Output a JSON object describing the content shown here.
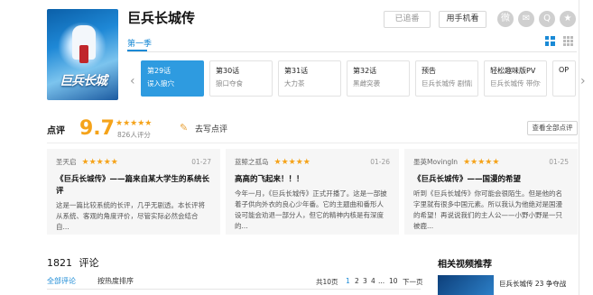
{
  "show": {
    "title": "巨兵长城传",
    "poster_text": "巨兵长城",
    "followed_label": "已追番",
    "phone_label": "用手机看"
  },
  "share_icons": [
    "weibo-icon",
    "wechat-icon",
    "qq-icon",
    "qzone-icon"
  ],
  "season_tab": "第一季",
  "episodes": [
    {
      "num": "第29话",
      "sub": "误入狼穴",
      "active": true
    },
    {
      "num": "第30话",
      "sub": "狼口夺食",
      "active": false
    },
    {
      "num": "第31话",
      "sub": "大力茶",
      "active": false
    },
    {
      "num": "第32话",
      "sub": "黑雌突袭",
      "active": false
    },
    {
      "num": "预告",
      "sub": "巨兵长城传 剧情版预告，超酷上线",
      "active": false
    },
    {
      "num": "轻松趣味版PV",
      "sub": "巨兵长城传 带你认识一只吃草的狼",
      "active": false
    },
    {
      "num": "OP",
      "sub": "",
      "active": false
    }
  ],
  "rating": {
    "heading": "点评",
    "score": "9.7",
    "stars": "★★★★★",
    "count": "826人评分",
    "write_label": "去写点评",
    "all_label": "查看全部点评"
  },
  "reviews": [
    {
      "user": "圣天启",
      "stars": "★★★★★",
      "date": "01-27",
      "title": "《巨兵长城传》——篇来自某大学生的系统长评",
      "body": "这是一篇比较系统的长评，几乎无剧透。本长评将从系统、客观的角度评价，尽管实际必然会结合自..."
    },
    {
      "user": "蓝鲸之孤岛",
      "stars": "★★★★★",
      "date": "01-26",
      "title": "高高的飞起来！！！",
      "body": "今年一月，《巨兵长城传》正式开播了。这是一部披着子供向外衣的良心少年番。它的主题曲和番形人设可能会劝退一部分人，但它的精神内核是有深度的..."
    },
    {
      "user": "墨英MovingIn",
      "stars": "★★★★★",
      "date": "01-25",
      "title": "《巨兵长城传》——国漫的希望",
      "body": "听到《巨兵长城传》你可能会很陌生。但是他的名字里就有很多中国元素。所以我认为他绝对是国漫的希望！再说说我们的主人公——小野小野是一只被鹿..."
    }
  ],
  "comments": {
    "count": "1821",
    "label": "评论",
    "tab_all": "全部评论",
    "sort": "按热度排序",
    "total_pages": "共10页",
    "pages": [
      "1",
      "2",
      "3",
      "4",
      "...",
      "10",
      "下一页"
    ]
  },
  "related": {
    "heading": "相关视频推荐",
    "first_title": "巨兵长城传 23 争夺战"
  },
  "colors": {
    "accent": "#1a8ad6",
    "star": "#f5a31a",
    "active_episode": "#2e9be0"
  }
}
